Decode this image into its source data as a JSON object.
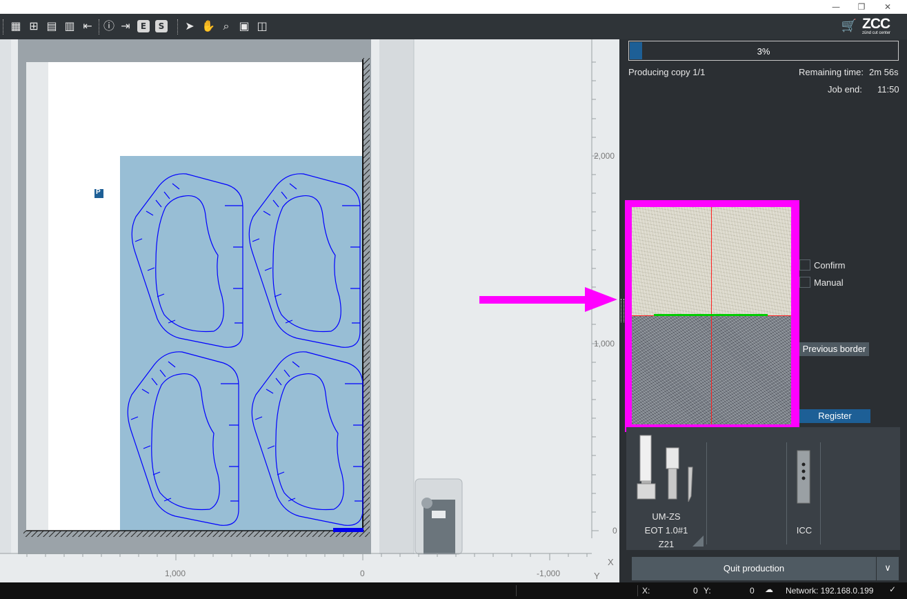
{
  "window": {
    "minimize_icon": "minimize-icon",
    "restore_icon": "restore-icon",
    "close_icon": "close-icon"
  },
  "toolbar": {
    "icons": [
      "layout-add-icon",
      "layout-distribute-icon",
      "layout-align-icon",
      "layout-fp-icon",
      "layout-edge-icon",
      "info-icon",
      "export-icon",
      "e-icon",
      "s-icon",
      "pointer-icon",
      "hand-icon",
      "zoom-icon",
      "fit-icon",
      "fit-width-icon",
      "cart-icon",
      "zcc-logo"
    ],
    "e_label": "E",
    "s_label": "S",
    "logo_text": "ZCC",
    "logo_subtext": "zünd cut center"
  },
  "canvas": {
    "ruler_y": [
      "2,000",
      "1,000",
      "0"
    ],
    "ruler_x": [
      "1,000",
      "0",
      "-1,000"
    ],
    "axis_x_label": "X",
    "axis_y_label": "Y",
    "marker_label": "P",
    "colors": {
      "board": "#98bed5",
      "cut": "#0000ff",
      "highlight": "#ff00ff",
      "edge_line": "#00cc00"
    }
  },
  "panel": {
    "progress_percent": 3,
    "progress_label": "3%",
    "producing": "Producing copy 1/1",
    "remaining_label": "Remaining time:",
    "remaining_value": "2m 56s",
    "jobend_label": "Job end:",
    "jobend_value": "11:50",
    "confirm_label": "Confirm",
    "manual_label": "Manual",
    "previous_border": "Previous border",
    "register": "Register",
    "tools": [
      {
        "name": "UM-ZS",
        "line2": "EOT 1.0#1",
        "line3": "Z21"
      },
      {
        "name": "ICC"
      }
    ],
    "quit": "Quit production"
  },
  "status": {
    "x_label": "X:",
    "x_value": "0",
    "y_label": "Y:",
    "y_value": "0",
    "network": "Network: 192.168.0.199"
  }
}
